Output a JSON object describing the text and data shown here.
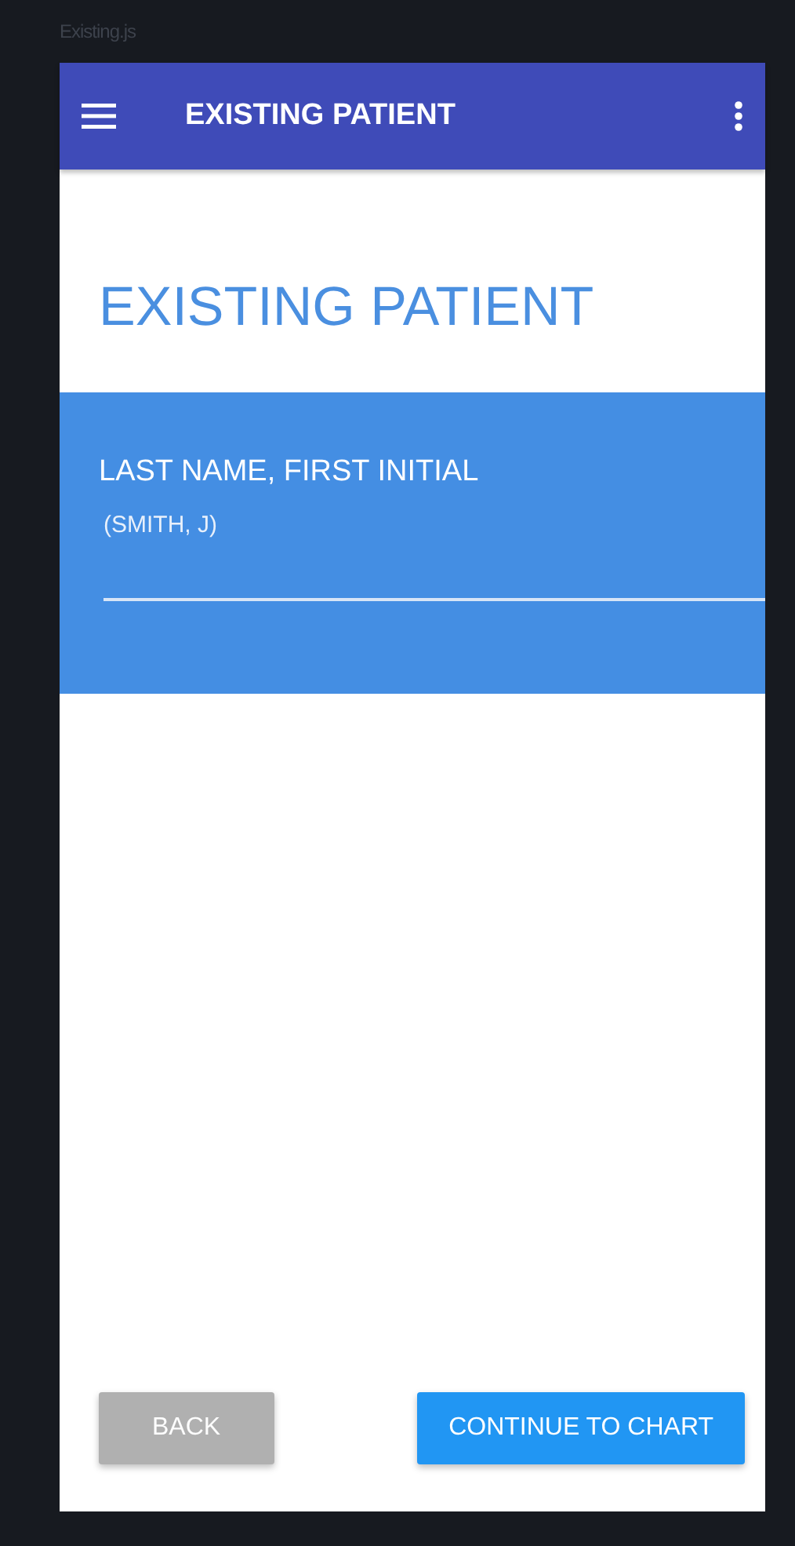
{
  "file_label": "Existing.js",
  "app_bar": {
    "title": "EXISTING PATIENT"
  },
  "heading": "EXISTING PATIENT",
  "name_field": {
    "label": "LAST NAME, FIRST INITIAL",
    "placeholder": "(SMITH, J)"
  },
  "buttons": [
    {
      "label": "BACK",
      "kind": "back",
      "disabled": true
    },
    {
      "label": "CONTINUE TO CHART",
      "kind": "primary",
      "disabled": false
    }
  ]
}
